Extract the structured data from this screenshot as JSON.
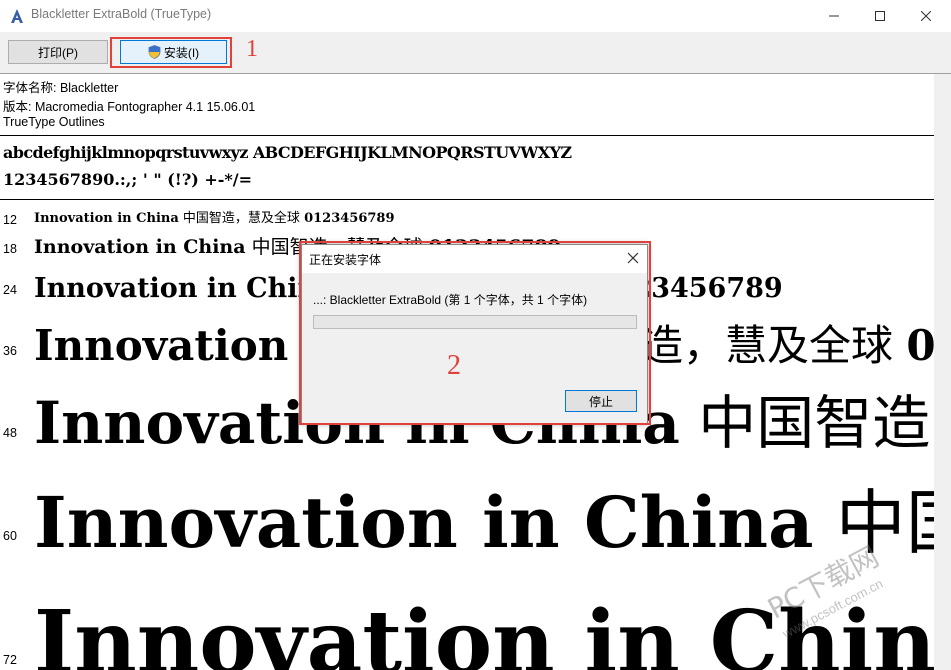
{
  "window": {
    "title": "Blackletter ExtraBold (TrueType)"
  },
  "toolbar": {
    "print_label": "打印(P)",
    "install_label": "安装(I)"
  },
  "annotations": {
    "marker_1": "1",
    "marker_2": "2",
    "highlight_color": "#e0413a"
  },
  "font_info": {
    "name_line": "字体名称: Blackletter",
    "version_line": "版本: Macromedia Fontographer 4.1 15.06.01",
    "type_line": "TrueType Outlines"
  },
  "charset": {
    "line1": "abcdefghijklmnopqrstuvwxyz ABCDEFGHIJKLMNOPQRSTUVWXYZ",
    "line2": "1234567890.:,; ' \" (!?) +-*/="
  },
  "samples": {
    "latin": "Innovation in China",
    "cjk": "中国智造，慧及全球",
    "digits": "0123456789",
    "sizes": [
      "12",
      "18",
      "24",
      "36",
      "48",
      "60",
      "72"
    ]
  },
  "dialog": {
    "title": "正在安装字体",
    "message": "...: Blackletter ExtraBold (第 1 个字体，共 1 个字体)",
    "progress": 0.0,
    "stop_label": "停止"
  },
  "watermark": {
    "text": "PC下载网",
    "url": "www.pcsoft.com.cn"
  }
}
